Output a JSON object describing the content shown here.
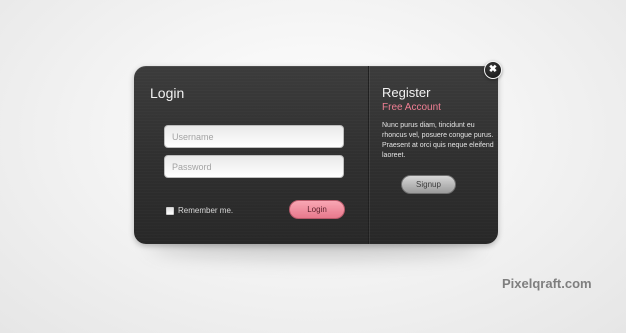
{
  "login": {
    "title": "Login",
    "username_placeholder": "Username",
    "password_placeholder": "Password",
    "remember_label": "Remember me.",
    "login_button": "Login"
  },
  "register": {
    "title": "Register",
    "subtitle": "Free Account",
    "body": "Nunc purus diam, tincidunt eu rhoncus vel, posuere congue purus. Praesent at orci quis neque eleifend laoreet.",
    "signup_button": "Signup"
  },
  "close": {
    "icon": "close-icon",
    "glyph": "✖"
  },
  "watermark": "Pixelqraft.com",
  "colors": {
    "accent_pink": "#f07e93",
    "panel_bg": "#2f2f2f"
  }
}
